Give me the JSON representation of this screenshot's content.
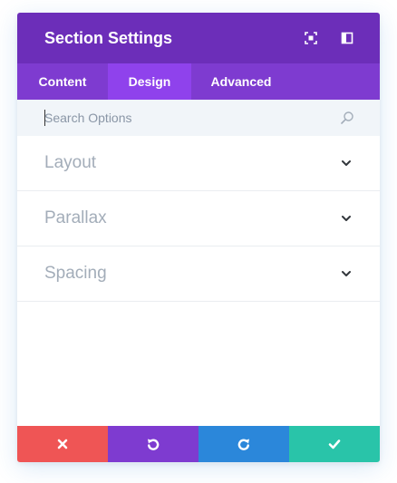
{
  "header": {
    "title": "Section Settings",
    "background": "#6c2eb9",
    "buttons": [
      {
        "icon": "fullscreen-icon"
      },
      {
        "icon": "split-view-icon"
      }
    ]
  },
  "tabs": {
    "background": "#7e3bd0",
    "active_background": "#8f42ec",
    "items": [
      {
        "label": "Content",
        "active": false
      },
      {
        "label": "Design",
        "active": true
      },
      {
        "label": "Advanced",
        "active": false
      }
    ]
  },
  "search": {
    "placeholder": "Search Options",
    "value": "",
    "icon": "search-icon"
  },
  "toggles": [
    {
      "label": "Layout",
      "icon": "chevron-down-icon"
    },
    {
      "label": "Parallax",
      "icon": "chevron-down-icon"
    },
    {
      "label": "Spacing",
      "icon": "chevron-down-icon"
    }
  ],
  "footer": {
    "buttons": [
      {
        "action": "discard",
        "icon": "close-icon",
        "color": "#ef5555"
      },
      {
        "action": "undo",
        "icon": "undo-icon",
        "color": "#7e3bd0"
      },
      {
        "action": "redo",
        "icon": "redo-icon",
        "color": "#2b87da"
      },
      {
        "action": "save",
        "icon": "check-icon",
        "color": "#29c4a9"
      }
    ]
  }
}
